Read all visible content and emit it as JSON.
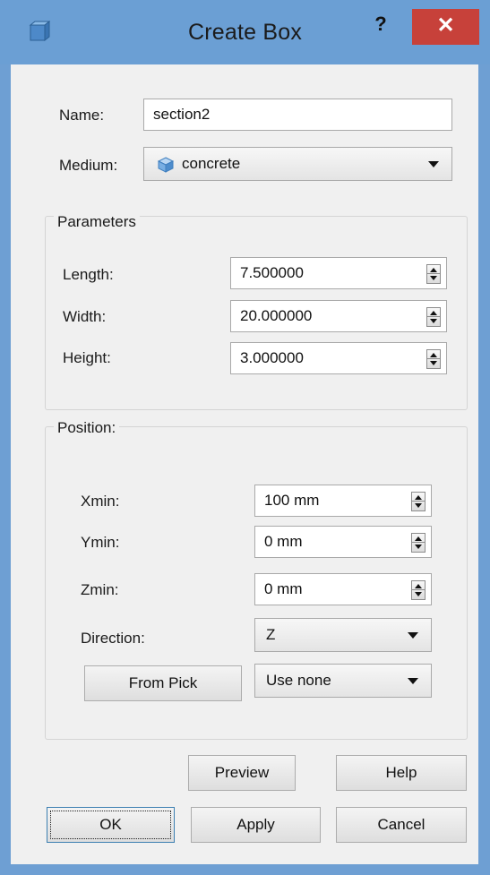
{
  "window": {
    "title": "Create Box",
    "help_label": "?",
    "close_label": "✕"
  },
  "form": {
    "name_label": "Name:",
    "name_value": "section2",
    "medium_label": "Medium:",
    "medium_value": "concrete"
  },
  "parameters": {
    "title": "Parameters",
    "fields": [
      {
        "label": "Length:",
        "value": "7.500000"
      },
      {
        "label": "Width:",
        "value": "20.000000"
      },
      {
        "label": "Height:",
        "value": "3.000000"
      }
    ]
  },
  "position": {
    "title": "Position:",
    "fields": [
      {
        "label": "Xmin:",
        "value": "100 mm"
      },
      {
        "label": "Ymin:",
        "value": "0 mm"
      },
      {
        "label": "Zmin:",
        "value": "0 mm"
      }
    ],
    "direction_label": "Direction:",
    "direction_value": "Z",
    "from_pick_label": "From Pick",
    "pick_mode_value": "Use none"
  },
  "buttons": {
    "preview": "Preview",
    "help": "Help",
    "ok": "OK",
    "apply": "Apply",
    "cancel": "Cancel"
  },
  "icons": {
    "app": "box-icon",
    "medium": "cube-icon"
  },
  "colors": {
    "titlebar": "#6b9fd4",
    "close": "#c7413a"
  }
}
